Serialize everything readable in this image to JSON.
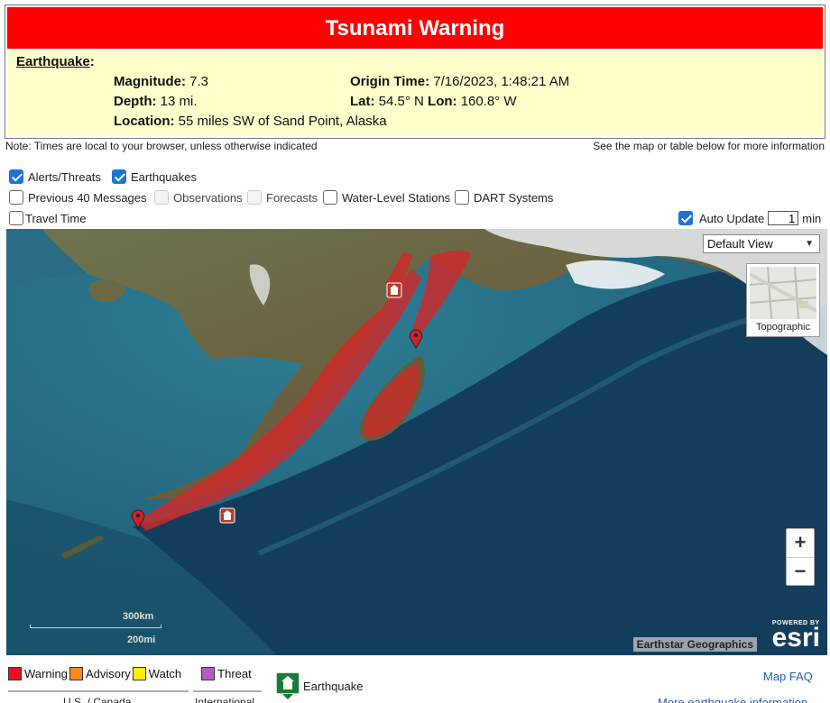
{
  "banner": {
    "title": "Tsunami Warning"
  },
  "earthquake": {
    "heading": "Earthquake",
    "heading_suffix": ":",
    "magnitude_label": "Magnitude:",
    "magnitude": "7.3",
    "origin_time_label": "Origin Time:",
    "origin_time": "7/16/2023, 1:48:21 AM",
    "depth_label": "Depth:",
    "depth": "13 mi.",
    "lat_label": "Lat:",
    "lat": "54.5° N",
    "lon_label": "Lon:",
    "lon": "160.8° W",
    "location_label": "Location:",
    "location": "55 miles SW of Sand Point, Alaska"
  },
  "notes": {
    "left": "Note: Times are local to your browser, unless otherwise indicated",
    "right": "See the map or table below for more information"
  },
  "layers": {
    "alerts_threats": {
      "label": "Alerts/Threats",
      "checked": true
    },
    "earthquakes": {
      "label": "Earthquakes",
      "checked": true
    },
    "previous_messages": {
      "label": "Previous 40 Messages",
      "checked": false
    },
    "observations": {
      "label": "Observations",
      "checked": false
    },
    "forecasts": {
      "label": "Forecasts",
      "checked": false
    },
    "water_level": {
      "label": "Water-Level Stations",
      "checked": false
    },
    "dart": {
      "label": "DART Systems",
      "checked": false
    },
    "travel_time": {
      "label": "Travel Time",
      "checked": false
    }
  },
  "auto_update": {
    "label": "Auto Update",
    "value": "1",
    "unit": "min",
    "checked": true
  },
  "map": {
    "view_select": "Default View",
    "basemap_label": "Topographic",
    "zoom_in": "+",
    "zoom_out": "−",
    "scale_km": "300km",
    "scale_mi": "200mi",
    "attribution": "Earthstar Geographics",
    "esri_powered": "POWERED BY",
    "esri_name": "esri"
  },
  "legend": {
    "items": [
      {
        "label": "Warning",
        "color": "#e8111b"
      },
      {
        "label": "Advisory",
        "color": "#f28c1e"
      },
      {
        "label": "Watch",
        "color": "#ffee00"
      },
      {
        "label": "Threat",
        "color": "#b35cc6"
      }
    ],
    "earthquake_label": "Earthquake",
    "us_canada": "U.S. / Canada",
    "international": "International"
  },
  "links": {
    "map_faq": "Map FAQ",
    "more_eq_info": "More earthquake information"
  },
  "colors": {
    "banner_red": "#ff0000",
    "panel_yellow": "#ffffcc",
    "checkbox_blue": "#1e72d8",
    "warning_zone": "#d42727",
    "ocean": "#1c5973"
  }
}
